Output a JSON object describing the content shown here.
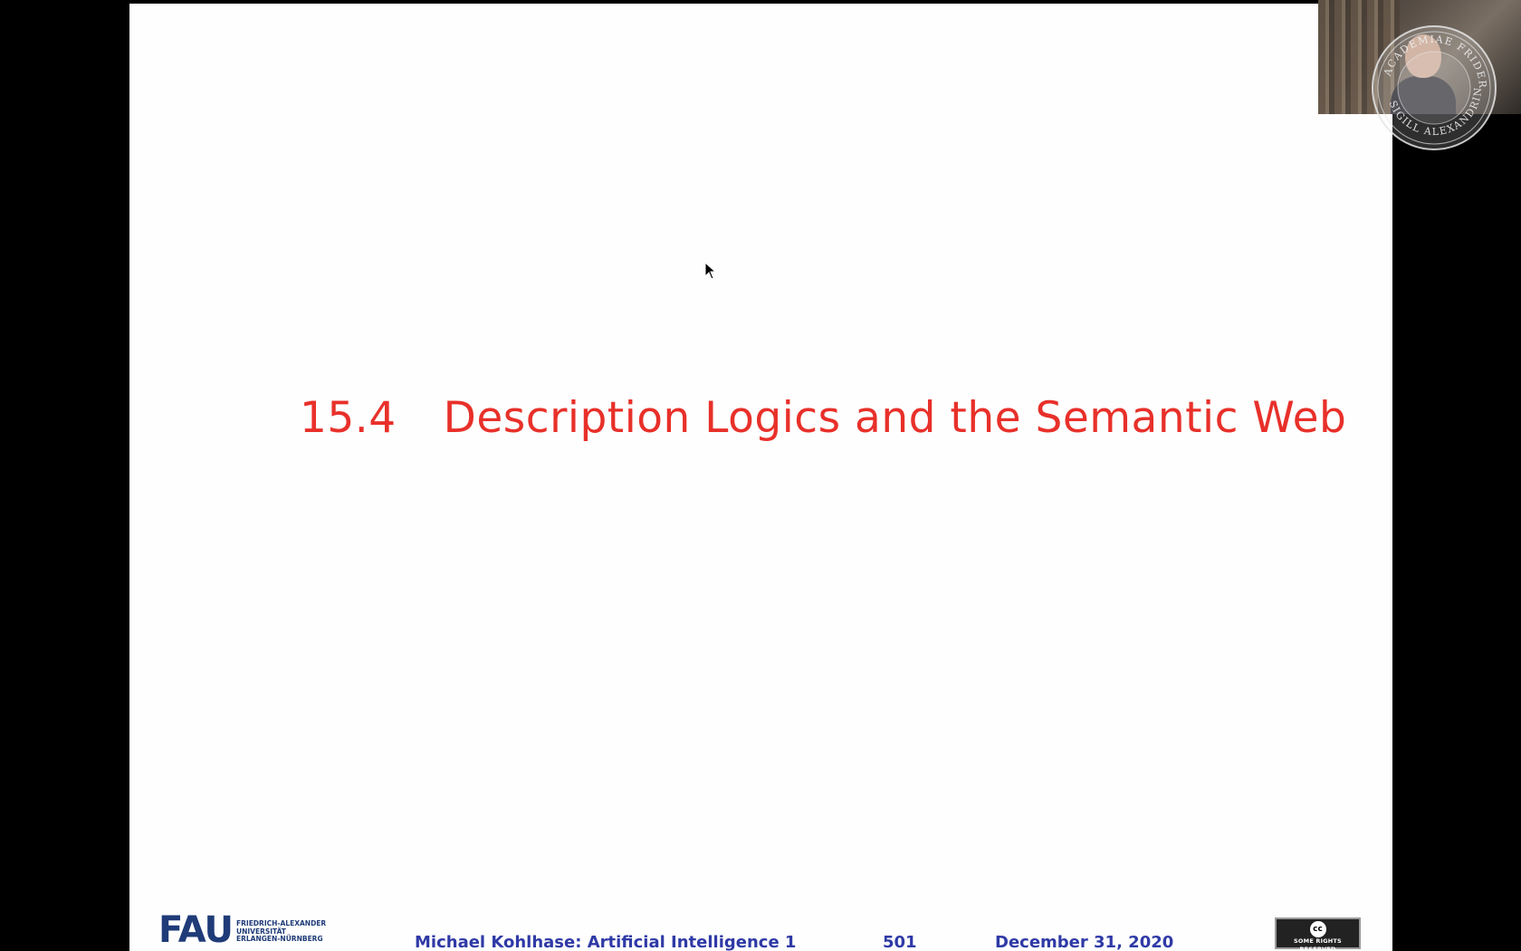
{
  "slide": {
    "section_number": "15.4",
    "section_title": "Description Logics and the Semantic Web"
  },
  "footer": {
    "logo": {
      "mark": "FAU",
      "lines": [
        "FRIEDRICH-ALEXANDER",
        "UNIVERSITÄT",
        "ERLANGEN-NÜRNBERG"
      ]
    },
    "author_course": "Michael Kohlhase: Artificial Intelligence 1",
    "page_number": "501",
    "date": "December 31, 2020",
    "license_badge": {
      "icon": "cc",
      "label": "SOME RIGHTS RESERVED"
    }
  },
  "overlay": {
    "seal_text": [
      "FRIDERICO",
      "ALEXANDRINAE",
      "SIGILL",
      "ACADEMIAE"
    ]
  },
  "colors": {
    "title": "#e8302a",
    "footer_text": "#2f3aa6",
    "background": "#000000",
    "slide_background": "#fefefe"
  }
}
